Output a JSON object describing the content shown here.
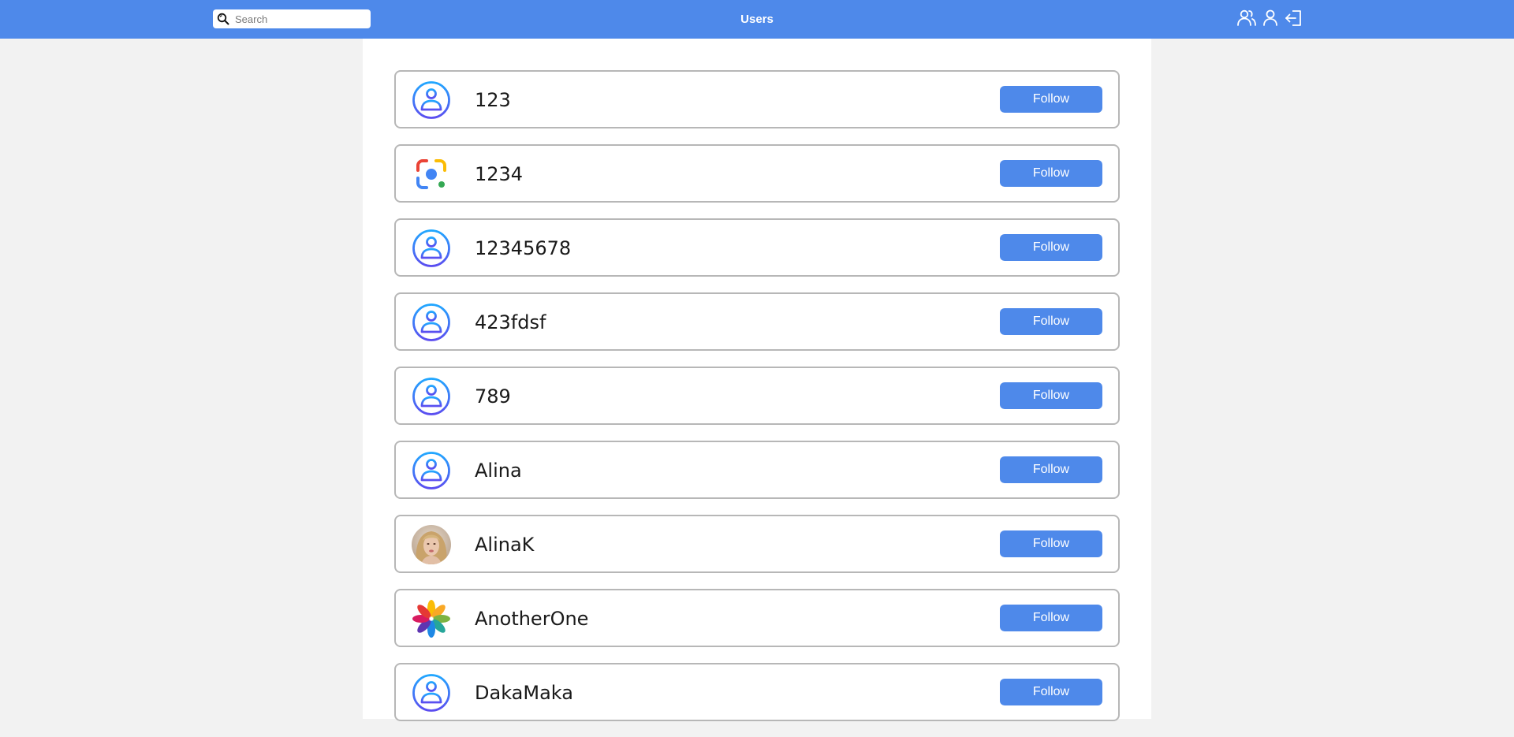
{
  "header": {
    "title": "Users",
    "search": {
      "placeholder": "Search",
      "value": ""
    },
    "nav_icons": [
      "users-icon",
      "profile-icon",
      "logout-icon"
    ]
  },
  "colors": {
    "accent": "#4e89ea",
    "background": "#f2f2f2",
    "card_border": "#b7b7b7"
  },
  "users": [
    {
      "name": "123",
      "avatar": "default-avatar-icon",
      "button": "Follow"
    },
    {
      "name": "1234",
      "avatar": "lens-avatar-icon",
      "button": "Follow"
    },
    {
      "name": "12345678",
      "avatar": "default-avatar-icon",
      "button": "Follow"
    },
    {
      "name": "423fdsf",
      "avatar": "default-avatar-icon",
      "button": "Follow"
    },
    {
      "name": "789",
      "avatar": "default-avatar-icon",
      "button": "Follow"
    },
    {
      "name": "Alina",
      "avatar": "default-avatar-icon",
      "button": "Follow"
    },
    {
      "name": "AlinaK",
      "avatar": "photo-avatar",
      "button": "Follow"
    },
    {
      "name": "AnotherOne",
      "avatar": "flower-avatar-icon",
      "button": "Follow"
    },
    {
      "name": "DakaMaka",
      "avatar": "default-avatar-icon",
      "button": "Follow"
    }
  ]
}
